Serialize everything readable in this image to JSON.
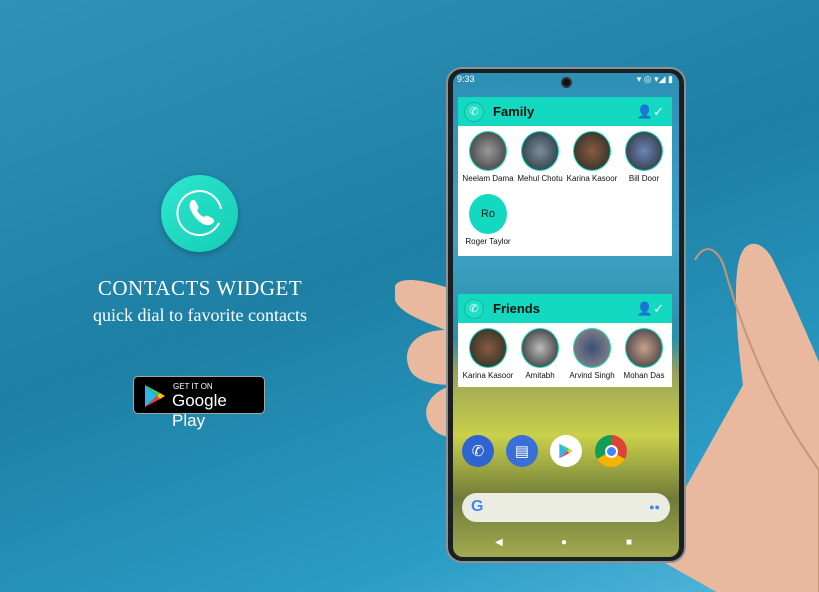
{
  "promo": {
    "title": "CONTACTS WIDGET",
    "subtitle": "quick dial to favorite contacts",
    "store_badge": {
      "line1": "GET IT ON",
      "line2": "Google Play"
    }
  },
  "colors": {
    "accent": "#12d9bf",
    "background": "#1d7fa3"
  },
  "phone": {
    "status_time": "9:33",
    "widgets": [
      {
        "title": "Family",
        "contacts": [
          {
            "name": "Neelam Dama"
          },
          {
            "name": "Mehul Chotu"
          },
          {
            "name": "Karina Kasoor"
          },
          {
            "name": "Bill Door"
          },
          {
            "name": "Roger Taylor",
            "initials": "Ro"
          }
        ]
      },
      {
        "title": "Friends",
        "contacts": [
          {
            "name": "Karina Kasoor"
          },
          {
            "name": "Amitabh"
          },
          {
            "name": "Arvind Singh"
          },
          {
            "name": "Mohan Das"
          }
        ]
      }
    ],
    "dock": [
      "phone-icon",
      "messages-icon",
      "play-store-icon",
      "chrome-icon"
    ],
    "search_icon": "google-g-icon"
  }
}
